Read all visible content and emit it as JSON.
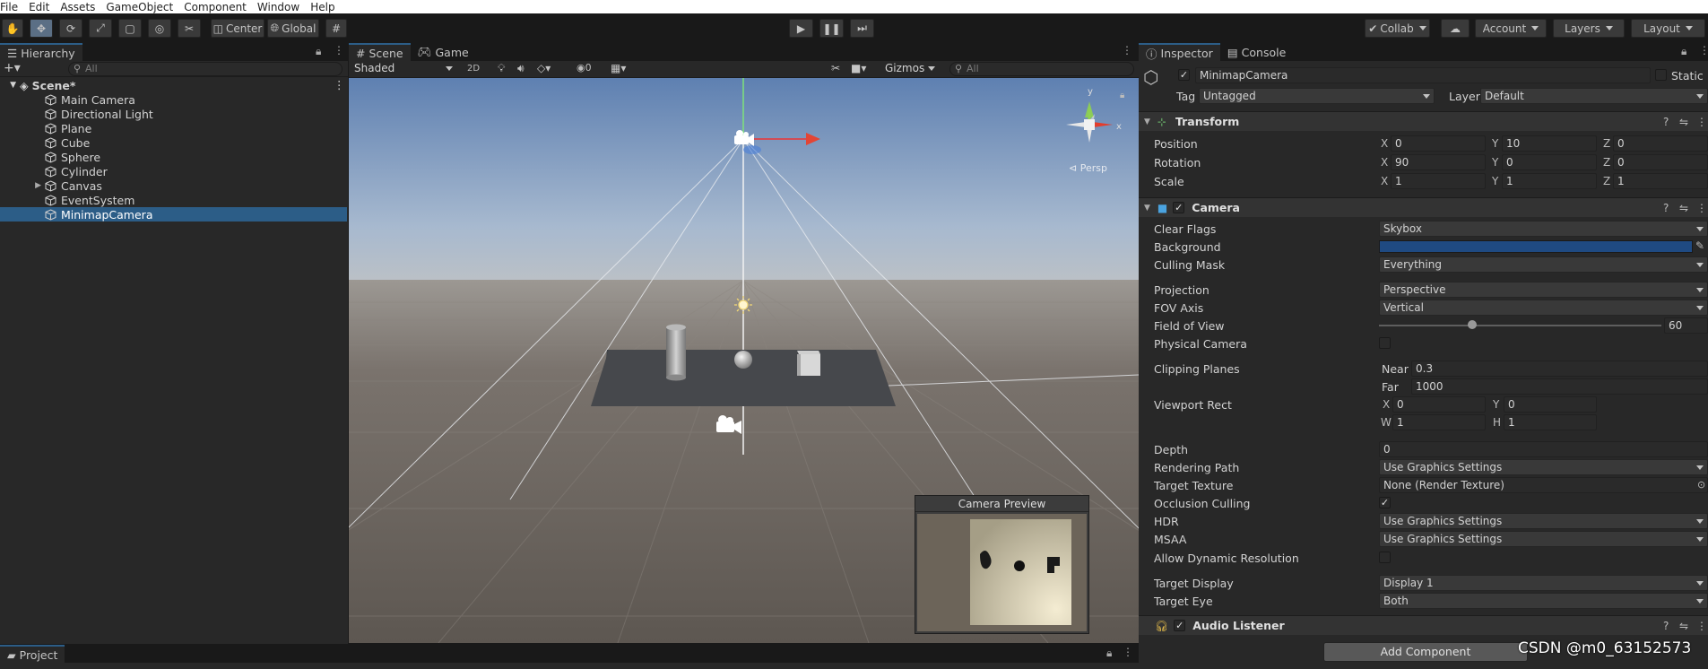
{
  "menu": [
    "File",
    "Edit",
    "Assets",
    "GameObject",
    "Component",
    "Window",
    "Help"
  ],
  "toolbar": {
    "pivot": "Center",
    "space": "Global",
    "collab": "Collab",
    "account": "Account",
    "layers": "Layers",
    "layout": "Layout"
  },
  "hierarchy": {
    "tab": "Hierarchy",
    "search_placeholder": "All",
    "scene": "Scene*",
    "items": [
      {
        "name": "Main Camera",
        "selected": false,
        "foldout": false
      },
      {
        "name": "Directional Light",
        "selected": false,
        "foldout": false
      },
      {
        "name": "Plane",
        "selected": false,
        "foldout": false
      },
      {
        "name": "Cube",
        "selected": false,
        "foldout": false
      },
      {
        "name": "Sphere",
        "selected": false,
        "foldout": false
      },
      {
        "name": "Cylinder",
        "selected": false,
        "foldout": false
      },
      {
        "name": "Canvas",
        "selected": false,
        "foldout": true
      },
      {
        "name": "EventSystem",
        "selected": false,
        "foldout": false
      },
      {
        "name": "MinimapCamera",
        "selected": true,
        "foldout": false
      }
    ]
  },
  "scene": {
    "tabs": [
      "Scene",
      "Game"
    ],
    "shading": "Shaded",
    "mode2d": "2D",
    "hidden_count": "0",
    "gizmos": "Gizmos",
    "search_placeholder": "All",
    "persp": "Persp",
    "axis_y": "y",
    "axis_x": "x",
    "preview_title": "Camera Preview"
  },
  "inspector": {
    "tabs": [
      "Inspector",
      "Console"
    ],
    "object_name": "MinimapCamera",
    "static_label": "Static",
    "tag_label": "Tag",
    "tag_value": "Untagged",
    "layer_label": "Layer",
    "layer_value": "Default",
    "transform": {
      "title": "Transform",
      "rows": [
        {
          "label": "Position",
          "x": "0",
          "y": "10",
          "z": "0"
        },
        {
          "label": "Rotation",
          "x": "90",
          "y": "0",
          "z": "0"
        },
        {
          "label": "Scale",
          "x": "1",
          "y": "1",
          "z": "1"
        }
      ]
    },
    "camera": {
      "title": "Camera",
      "clear_flags": {
        "label": "Clear Flags",
        "value": "Skybox"
      },
      "background": {
        "label": "Background",
        "color": "#1f4a82"
      },
      "culling_mask": {
        "label": "Culling Mask",
        "value": "Everything"
      },
      "projection": {
        "label": "Projection",
        "value": "Perspective"
      },
      "fov_axis": {
        "label": "FOV Axis",
        "value": "Vertical"
      },
      "fov": {
        "label": "Field of View",
        "value": "60",
        "min": 1,
        "max": 179,
        "slider": 60
      },
      "physical": {
        "label": "Physical Camera"
      },
      "clipping": {
        "label": "Clipping Planes",
        "near_label": "Near",
        "near": "0.3",
        "far_label": "Far",
        "far": "1000"
      },
      "viewport": {
        "label": "Viewport Rect",
        "x": "0",
        "y": "0",
        "w": "1",
        "h": "1"
      },
      "depth": {
        "label": "Depth",
        "value": "0"
      },
      "rendering_path": {
        "label": "Rendering Path",
        "value": "Use Graphics Settings"
      },
      "target_texture": {
        "label": "Target Texture",
        "value": "None (Render Texture)"
      },
      "occlusion": {
        "label": "Occlusion Culling"
      },
      "hdr": {
        "label": "HDR",
        "value": "Use Graphics Settings"
      },
      "msaa": {
        "label": "MSAA",
        "value": "Use Graphics Settings"
      },
      "dynres": {
        "label": "Allow Dynamic Resolution"
      },
      "target_display": {
        "label": "Target Display",
        "value": "Display 1"
      },
      "target_eye": {
        "label": "Target Eye",
        "value": "Both"
      }
    },
    "audio_listener": "Audio Listener",
    "add_component": "Add Component"
  },
  "project": {
    "tab": "Project"
  },
  "watermark": "CSDN @m0_63152573",
  "colors": {
    "selection": "#2c5d87",
    "accent": "#3c82c8"
  }
}
